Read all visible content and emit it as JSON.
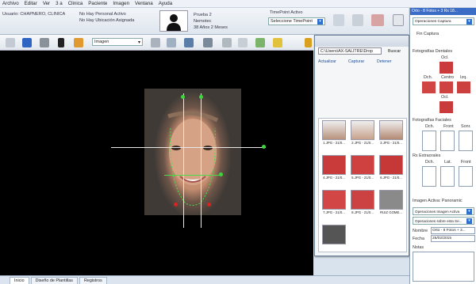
{
  "menu": [
    "Archivo",
    "Editar",
    "Ver",
    "3 a",
    "Clinica",
    "Paciente",
    "Imagen",
    "Ventana",
    "Ayuda"
  ],
  "info": {
    "usuario": "Usuario: CHAPNERO, CLINICA",
    "personal": "No Hay Personal Activo",
    "ubicacion": "No Hay Ubicación Asignada",
    "paciente": "Prueba 2",
    "apellido": "Nemotec",
    "edad": "38 Años 2 Meses",
    "timepoint_label": "TimePoint Activo",
    "timepoint_select": "Seleccione TimePoint"
  },
  "toolbar": {
    "image_select": "Imagen"
  },
  "window": {
    "path": "C:\\Users\\AX-SALITRE\\Drop",
    "buscar": "Buscar",
    "actualizar": "Actualizar",
    "capturar": "Capturar",
    "detener": "Detener",
    "thumbs": [
      {
        "label": "1.JPG - 21/0...",
        "color": "#b8937d"
      },
      {
        "label": "2.JPG - 21/0...",
        "color": "#c7a28c"
      },
      {
        "label": "3.JPG - 21/0...",
        "color": "#b48a74"
      },
      {
        "label": "4.JPG - 21/0...",
        "color": "#c93a3a"
      },
      {
        "label": "5.JPG - 21/0...",
        "color": "#cf4040"
      },
      {
        "label": "6.JPG - 21/0...",
        "color": "#c63838"
      },
      {
        "label": "7.JPG - 21/0...",
        "color": "#d24646"
      },
      {
        "label": "8.JPG - 21/0...",
        "color": "#cc4242"
      },
      {
        "label": "RUIZ GOME...",
        "color": "#8a8a8a"
      },
      {
        "label": "",
        "color": "#555555"
      }
    ]
  },
  "right": {
    "header": "Orto - 8 Fotos + 3 Rx 18...",
    "operaciones_captura": "Operaciones Captura",
    "fin_captura": "Fin Captura",
    "fotos_dentales": "Fotografías Dentales",
    "ocl_top": "Ocl.",
    "dch": "Dch.",
    "centro": "Centro",
    "izq": "Izq.",
    "ocl_bottom": "Ocl.",
    "fotos_faciales": "Fotografías Faciales",
    "f_dch": "Dch.",
    "f_front": "Front",
    "f_sonr": "Sonr.",
    "rx": "Rx Extraorales",
    "rx_dch": "Dch.",
    "rx_lat": "Lat.",
    "rx_front": "Front",
    "imagen_activa": "Imagen Activa:  Panoramic",
    "op_imagen": "Operaciones Imagen Activa",
    "op_sobre": "Operaciones sobre esta Se...",
    "nombre_label": "Nombre",
    "nombre_value": "Orto - 8 Fotos + 3...",
    "fecha_label": "Fecha",
    "fecha_value": "25/02/2015",
    "notas": "Notas"
  },
  "status_tabs": [
    "Inicio",
    "Diseño de Plantillas",
    "Registros"
  ]
}
